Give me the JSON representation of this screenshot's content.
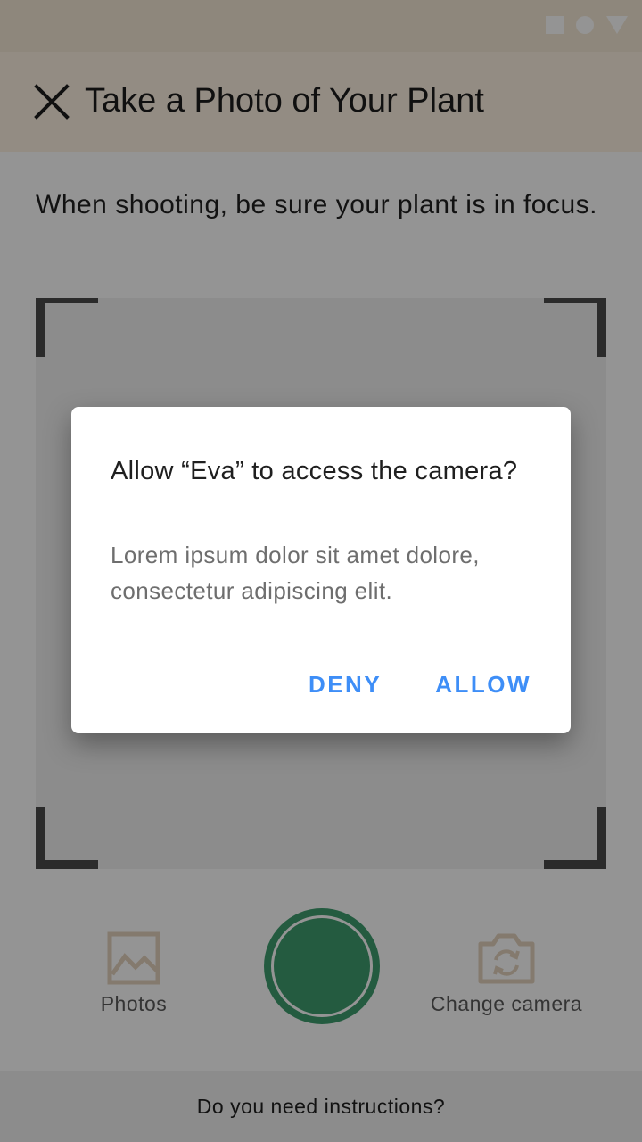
{
  "app_bar": {
    "title": "Take a Photo of Your Plant",
    "close_icon": "close-icon"
  },
  "status_bar": {
    "icons": [
      "square-icon",
      "circle-icon",
      "triangle-icon"
    ]
  },
  "main": {
    "instructions": "When shooting, be sure your plant is in focus."
  },
  "controls": {
    "photos_label": "Photos",
    "photos_icon": "image-icon",
    "change_camera_label": "Change camera",
    "change_camera_icon": "switch-camera-icon",
    "shutter_color": "#3f9e6f"
  },
  "bottom_bar": {
    "text": "Do you need instructions?"
  },
  "dialog": {
    "title": "Allow “Eva” to access the camera?",
    "body": "Lorem ipsum dolor sit amet dolore, consectetur adipiscing elit.",
    "deny_label": "DENY",
    "allow_label": "ALLOW",
    "accent_color": "#3e8ef7"
  },
  "colors": {
    "header_bg": "#fdf1e2",
    "status_bar_bg": "#f4e8d6",
    "scrim": "rgba(0,0,0,0.42)"
  }
}
